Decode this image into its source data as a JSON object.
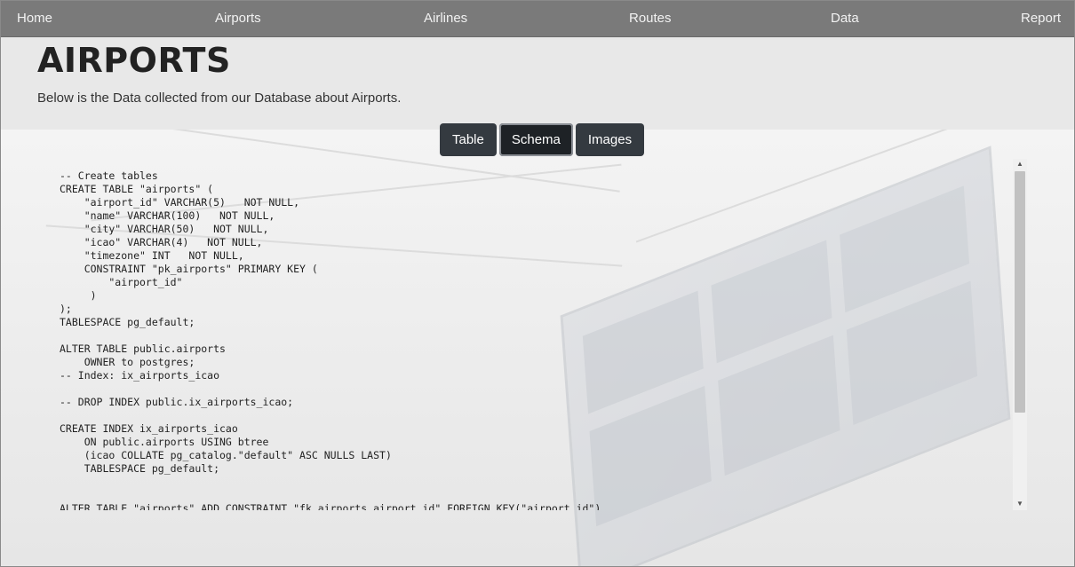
{
  "nav": {
    "items": [
      {
        "label": "Home"
      },
      {
        "label": "Airports"
      },
      {
        "label": "Airlines"
      },
      {
        "label": "Routes"
      },
      {
        "label": "Data"
      },
      {
        "label": "Report"
      }
    ]
  },
  "header": {
    "title": "AIRPORTS",
    "subtitle": "Below is the Data collected from our Database about Airports."
  },
  "tabs": {
    "table": "Table",
    "schema": "Schema",
    "images": "Images",
    "active": "Schema"
  },
  "schema_code": "-- Create tables\nCREATE TABLE \"airports\" (\n    \"airport_id\" VARCHAR(5)   NOT NULL,\n    \"name\" VARCHAR(100)   NOT NULL,\n    \"city\" VARCHAR(50)   NOT NULL,\n    \"icao\" VARCHAR(4)   NOT NULL,\n    \"timezone\" INT   NOT NULL,\n    CONSTRAINT \"pk_airports\" PRIMARY KEY (\n        \"airport_id\"\n     )\n);\nTABLESPACE pg_default;\n\nALTER TABLE public.airports\n    OWNER to postgres;\n-- Index: ix_airports_icao\n\n-- DROP INDEX public.ix_airports_icao;\n\nCREATE INDEX ix_airports_icao\n    ON public.airports USING btree\n    (icao COLLATE pg_catalog.\"default\" ASC NULLS LAST)\n    TABLESPACE pg_default;\n\n\nALTER TABLE \"airports\" ADD CONSTRAINT \"fk_airports_airport_id\" FOREIGN KEY(\"airport_id\")",
  "scrollbar": {
    "up_arrow": "▲",
    "down_arrow": "▼"
  }
}
